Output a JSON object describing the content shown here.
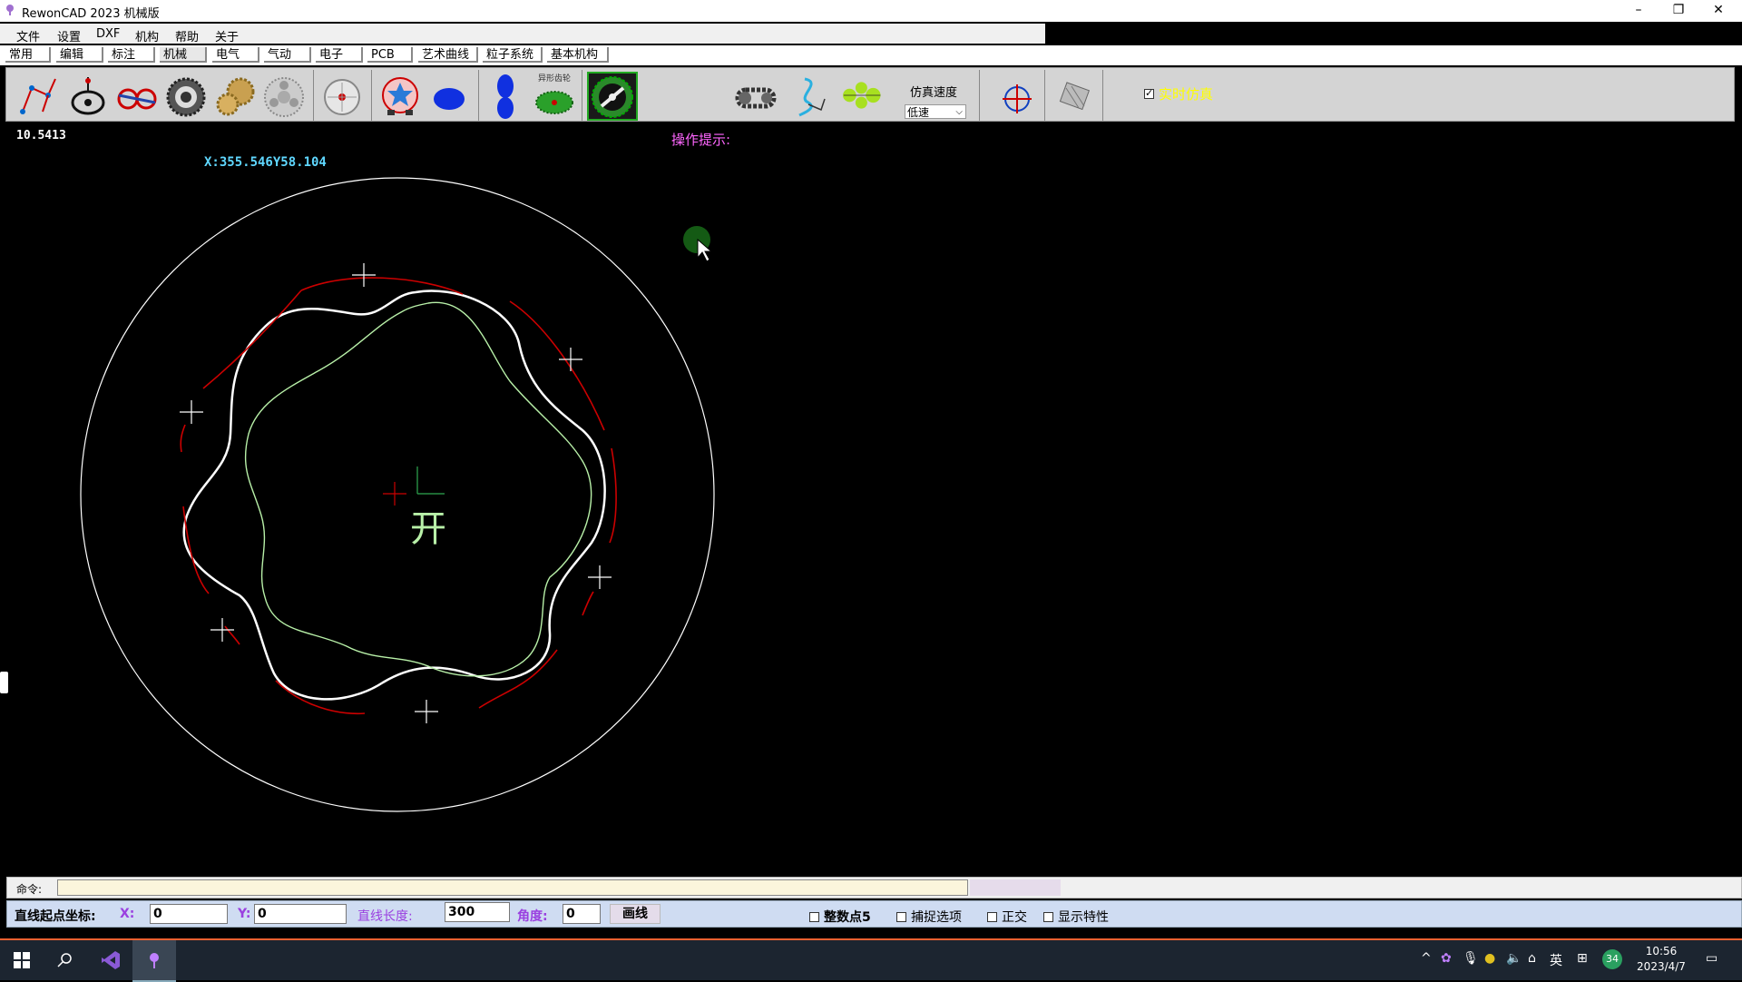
{
  "window": {
    "title": "RewonCAD 2023 机械版",
    "controls": [
      "–",
      "❐",
      "✕"
    ]
  },
  "menu": [
    "文件",
    "设置",
    "DXF",
    "机构",
    "帮助",
    "关于"
  ],
  "tabs": [
    "常用",
    "编辑",
    "标注",
    "机械",
    "电气",
    "气动",
    "电子",
    "PCB",
    "艺术曲线",
    "粒子系统",
    "基本机构"
  ],
  "active_tab": "机械",
  "toolbar": {
    "icons": [
      "linkage-icon",
      "cam-icon",
      "gear-train-icon",
      "gear-ring-icon",
      "gear-pair-icon",
      "planetary-gear-icon",
      "flywheel-icon",
      "star-gear-icon",
      "ellipse-gear-icon",
      "noncircular-gear-icon",
      "shaped-gear-icon",
      "internal-gear-icon",
      "chain-icon",
      "spline-link-icon",
      "rotor-icon",
      "target-icon",
      "screw-icon"
    ],
    "shaped_gear_label": "异形齿轮",
    "sim_speed_label": "仿真速度",
    "sim_speed_value": "低速",
    "realtime_label": "实时仿真",
    "realtime_checked": true
  },
  "canvas": {
    "top_value": "10.5413",
    "coord_readout": "X:355.546Y58.104",
    "hint": "操作提示:",
    "center_label": "开",
    "colors": {
      "background": "#000000",
      "outer_circle": "#ffffff",
      "rotor": "#ffffff",
      "inner_curve": "#b8f0a8",
      "arcs": "#cc0000",
      "center_mark": "#2fa84f"
    }
  },
  "command": {
    "label": "命令:",
    "value": ""
  },
  "status": {
    "start_label": "直线起点坐标:",
    "x_label": "X:",
    "x_value": "0",
    "y_label": "Y:",
    "y_value": "0",
    "length_label": "直线长度:",
    "length_value": "300",
    "angle_label": "角度:",
    "angle_value": "0",
    "draw_button": "画线",
    "options": [
      {
        "label": "整数点5",
        "checked": false
      },
      {
        "label": "捕捉选项",
        "checked": false
      },
      {
        "label": "正交",
        "checked": false
      },
      {
        "label": "显示特性",
        "checked": false
      }
    ]
  },
  "taskbar": {
    "tray": [
      "^",
      "英",
      "34"
    ],
    "time": "10:56",
    "date": "2023/4/7"
  }
}
